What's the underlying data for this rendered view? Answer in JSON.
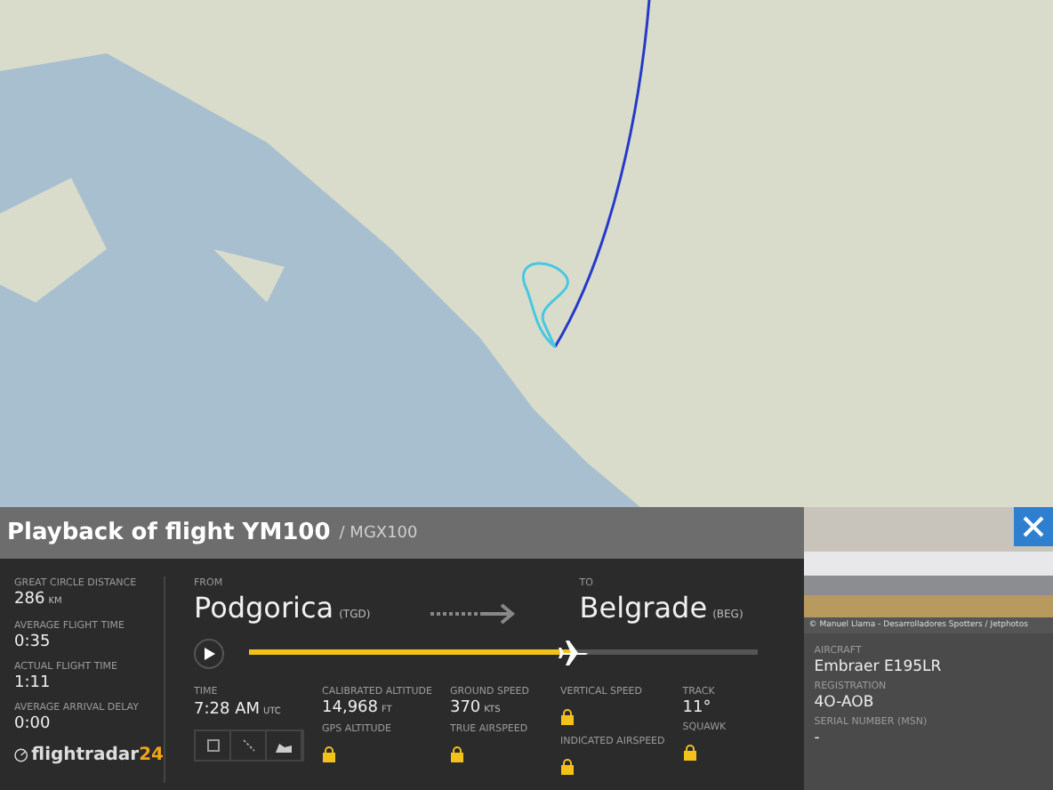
{
  "header": {
    "title": "Playback of flight YM100",
    "callsign": "/ MGX100"
  },
  "summary": [
    {
      "label": "GREAT CIRCLE DISTANCE",
      "value": "286",
      "unit": "KM"
    },
    {
      "label": "AVERAGE FLIGHT TIME",
      "value": "0:35"
    },
    {
      "label": "ACTUAL FLIGHT TIME",
      "value": "1:11"
    },
    {
      "label": "AVERAGE ARRIVAL DELAY",
      "value": "0:00"
    }
  ],
  "logo": {
    "name": "flightradar",
    "suffix": "24"
  },
  "route": {
    "from_label": "FROM",
    "from_city": "Podgorica",
    "from_code": "(TGD)",
    "to_label": "TO",
    "to_city": "Belgrade",
    "to_code": "(BEG)"
  },
  "playback": {
    "level": 0.64
  },
  "time": {
    "label": "TIME",
    "value": "7:28 AM",
    "unit": "UTC"
  },
  "stats": [
    {
      "items": [
        {
          "label": "CALIBRATED ALTITUDE",
          "kind": "text",
          "value": "14,968",
          "unit": "FT"
        },
        {
          "label": "GPS ALTITUDE",
          "kind": "locked"
        }
      ]
    },
    {
      "items": [
        {
          "label": "GROUND SPEED",
          "kind": "text",
          "value": "370",
          "unit": "KTS"
        },
        {
          "label": "TRUE AIRSPEED",
          "kind": "locked"
        }
      ]
    },
    {
      "items": [
        {
          "label": "VERTICAL SPEED",
          "kind": "locked"
        },
        {
          "label": "INDICATED AIRSPEED",
          "kind": "locked"
        }
      ]
    },
    {
      "items": [
        {
          "label": "TRACK",
          "kind": "text",
          "value": "11°"
        },
        {
          "label": "SQUAWK",
          "kind": "locked"
        }
      ]
    }
  ],
  "photo": {
    "credit": "© Manuel Llama - Desarrolladores Spotters / Jetphotos"
  },
  "aircraft": [
    {
      "label": "AIRCRAFT",
      "value": "Embraer E195LR"
    },
    {
      "label": "REGISTRATION",
      "value": "4O-AOB"
    },
    {
      "label": "SERIAL NUMBER (MSN)",
      "value": "-"
    }
  ]
}
